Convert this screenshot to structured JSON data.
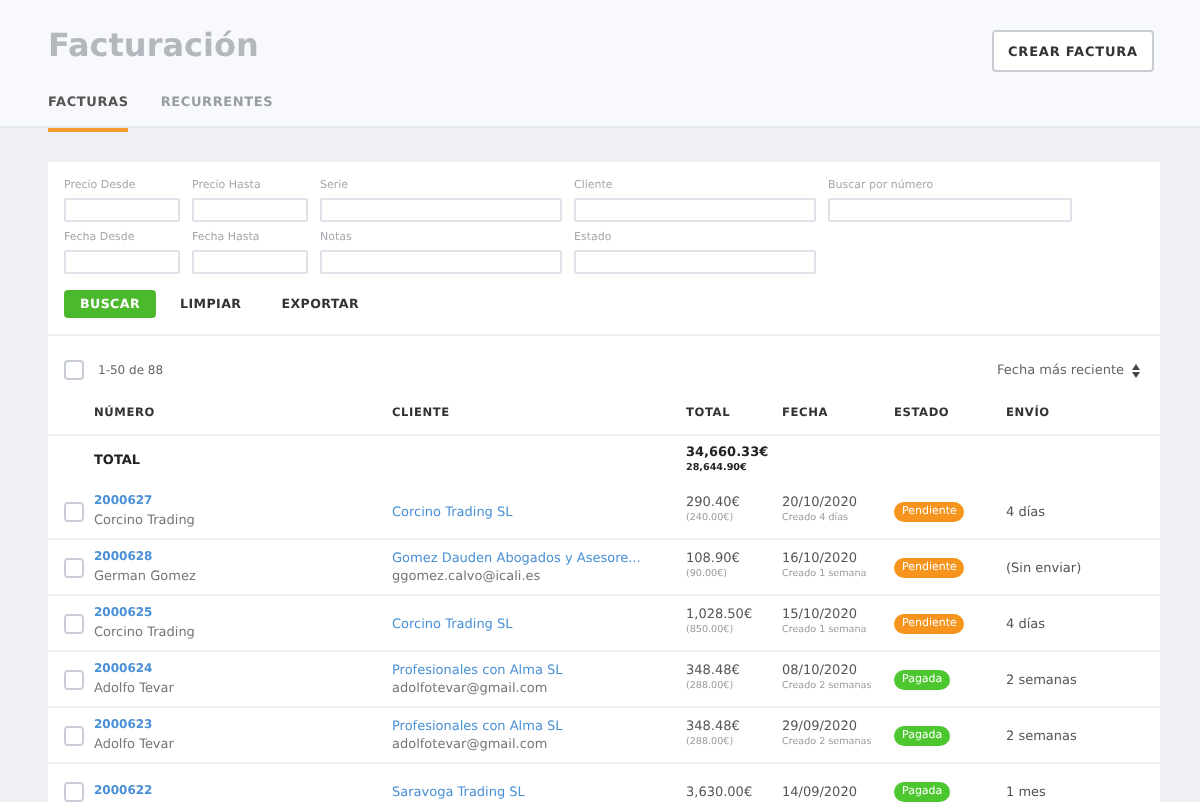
{
  "header": {
    "title": "Facturación",
    "create_button": "CREAR FACTURA"
  },
  "tabs": [
    {
      "label": "FACTURAS",
      "selected": true
    },
    {
      "label": "RECURRENTES",
      "selected": false
    }
  ],
  "filters": {
    "fields": [
      {
        "label": "Precio Desde"
      },
      {
        "label": "Precio Hasta"
      },
      {
        "label": "Serie"
      },
      {
        "label": "Cliente"
      },
      {
        "label": "Buscar por número"
      },
      {
        "label": "Fecha Desde"
      },
      {
        "label": "Fecha Hasta"
      },
      {
        "label": "Notas"
      },
      {
        "label": "Estado"
      }
    ],
    "buttons": [
      {
        "label": "BUSCAR",
        "kind": "primary"
      },
      {
        "label": "LIMPIAR",
        "kind": "plain"
      },
      {
        "label": "EXPORTAR",
        "kind": "plain"
      }
    ]
  },
  "table": {
    "select_all": {
      "checked": false
    },
    "range": "1-50 de 88",
    "sort": "Fecha más reciente",
    "columns": [
      "NÚMERO",
      "CLIENTE",
      "TOTAL",
      "FECHA",
      "ESTADO",
      "ENVÍO"
    ],
    "total": {
      "label": "TOTAL",
      "amount": "34,660.33€",
      "net": "28,644.90€"
    },
    "rows": [
      {
        "checked": false,
        "number": "2000627",
        "name": "Corcino Trading",
        "client": "Corcino Trading SL",
        "email": "",
        "total": "290.40€",
        "net": "(240.00€)",
        "date": "20/10/2020",
        "created": "Creado 4 días",
        "status": "Pendiente",
        "color": "#f7941d",
        "sent": "4 días"
      },
      {
        "checked": false,
        "number": "2000628",
        "name": "German Gomez",
        "client": "Gomez Dauden Abogados y Asesore...",
        "email": "ggomez.calvo@icali.es",
        "total": "108.90€",
        "net": "(90.00€)",
        "date": "16/10/2020",
        "created": "Creado 1 semana",
        "status": "Pendiente",
        "color": "#f7941d",
        "sent": "(Sin enviar)"
      },
      {
        "checked": false,
        "number": "2000625",
        "name": "Corcino Trading",
        "client": "Corcino Trading SL",
        "email": "",
        "total": "1,028.50€",
        "net": "(850.00€)",
        "date": "15/10/2020",
        "created": "Creado 1 semana",
        "status": "Pendiente",
        "color": "#f7941d",
        "sent": "4 días"
      },
      {
        "checked": false,
        "number": "2000624",
        "name": "Adolfo Tevar",
        "client": "Profesionales con Alma SL",
        "email": "adolfotevar@gmail.com",
        "total": "348.48€",
        "net": "(288.00€)",
        "date": "08/10/2020",
        "created": "Creado 2 semanas",
        "status": "Pagada",
        "color": "#4cc730",
        "sent": "2 semanas"
      },
      {
        "checked": false,
        "number": "2000623",
        "name": "Adolfo Tevar",
        "client": "Profesionales con Alma SL",
        "email": "adolfotevar@gmail.com",
        "total": "348.48€",
        "net": "(288.00€)",
        "date": "29/09/2020",
        "created": "Creado 2 semanas",
        "status": "Pagada",
        "color": "#4cc730",
        "sent": "2 semanas"
      },
      {
        "checked": false,
        "number": "2000622",
        "name": "",
        "client": "Saravoga Trading SL",
        "email": "",
        "total": "3,630.00€",
        "net": "",
        "date": "14/09/2020",
        "created": "",
        "status": "Pagada",
        "color": "#4cc730",
        "sent": "1 mes"
      }
    ]
  }
}
